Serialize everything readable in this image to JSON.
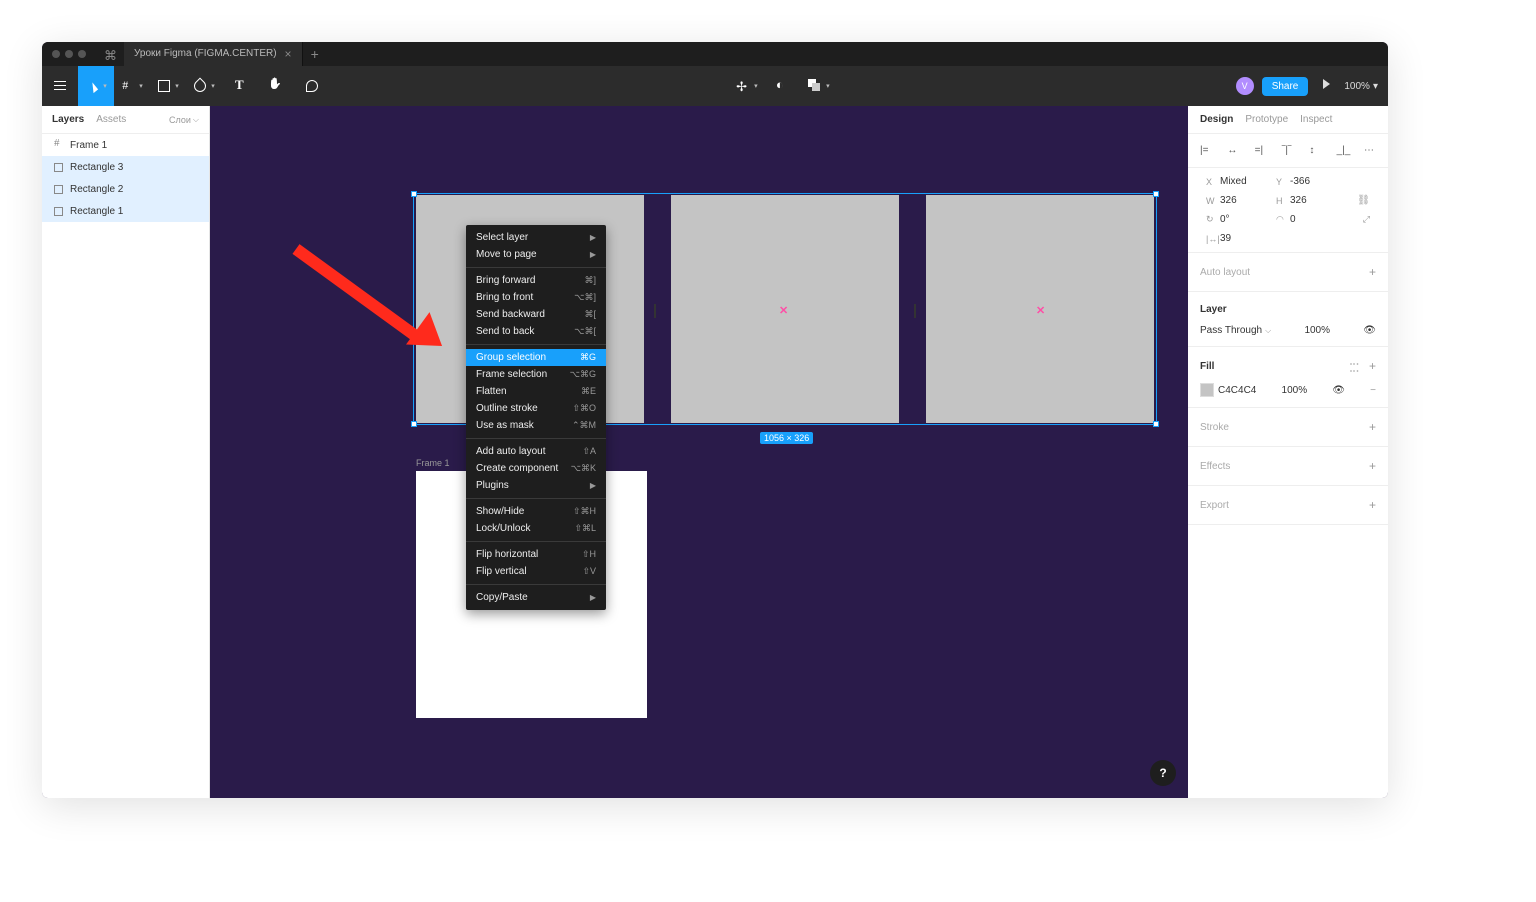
{
  "tabbar": {
    "title": "Уроки Figma (FIGMA.CENTER)"
  },
  "toolbar": {
    "share": "Share",
    "zoom": "100%"
  },
  "layers_panel": {
    "tab_layers": "Layers",
    "tab_assets": "Assets",
    "pages_label": "Слои",
    "items": [
      {
        "label": "Frame 1",
        "type": "frame",
        "selected": false
      },
      {
        "label": "Rectangle 3",
        "type": "rect",
        "selected": true
      },
      {
        "label": "Rectangle 2",
        "type": "rect",
        "selected": true
      },
      {
        "label": "Rectangle 1",
        "type": "rect",
        "selected": true
      }
    ]
  },
  "canvas": {
    "selection_badge": "1056 × 326",
    "frame_label": "Frame 1"
  },
  "context_menu": [
    [
      {
        "label": "Select layer",
        "shortcut": "",
        "submenu": true
      },
      {
        "label": "Move to page",
        "shortcut": "",
        "submenu": true
      }
    ],
    [
      {
        "label": "Bring forward",
        "shortcut": "⌘]"
      },
      {
        "label": "Bring to front",
        "shortcut": "⌥⌘]"
      },
      {
        "label": "Send backward",
        "shortcut": "⌘["
      },
      {
        "label": "Send to back",
        "shortcut": "⌥⌘["
      }
    ],
    [
      {
        "label": "Group selection",
        "shortcut": "⌘G",
        "highlight": true
      },
      {
        "label": "Frame selection",
        "shortcut": "⌥⌘G"
      },
      {
        "label": "Flatten",
        "shortcut": "⌘E"
      },
      {
        "label": "Outline stroke",
        "shortcut": "⇧⌘O"
      },
      {
        "label": "Use as mask",
        "shortcut": "⌃⌘M"
      }
    ],
    [
      {
        "label": "Add auto layout",
        "shortcut": "⇧A"
      },
      {
        "label": "Create component",
        "shortcut": "⌥⌘K"
      },
      {
        "label": "Plugins",
        "shortcut": "",
        "submenu": true
      }
    ],
    [
      {
        "label": "Show/Hide",
        "shortcut": "⇧⌘H"
      },
      {
        "label": "Lock/Unlock",
        "shortcut": "⇧⌘L"
      }
    ],
    [
      {
        "label": "Flip horizontal",
        "shortcut": "⇧H"
      },
      {
        "label": "Flip vertical",
        "shortcut": "⇧V"
      }
    ],
    [
      {
        "label": "Copy/Paste",
        "shortcut": "",
        "submenu": true
      }
    ]
  ],
  "right_panel": {
    "tabs": {
      "design": "Design",
      "prototype": "Prototype",
      "inspect": "Inspect"
    },
    "transform": {
      "x_label": "X",
      "x": "Mixed",
      "y_label": "Y",
      "y": "-366",
      "w_label": "W",
      "w": "326",
      "h_label": "H",
      "h": "326",
      "r_label": "↻",
      "r": "0°",
      "c_label": "◠",
      "c": "0",
      "gap_label": "|↔|",
      "gap": "39"
    },
    "auto_layout": "Auto layout",
    "layer": {
      "title": "Layer",
      "blend": "Pass Through",
      "opacity": "100%"
    },
    "fill": {
      "title": "Fill",
      "hex": "C4C4C4",
      "opacity": "100%"
    },
    "stroke": "Stroke",
    "effects": "Effects",
    "export": "Export"
  },
  "help": "?"
}
